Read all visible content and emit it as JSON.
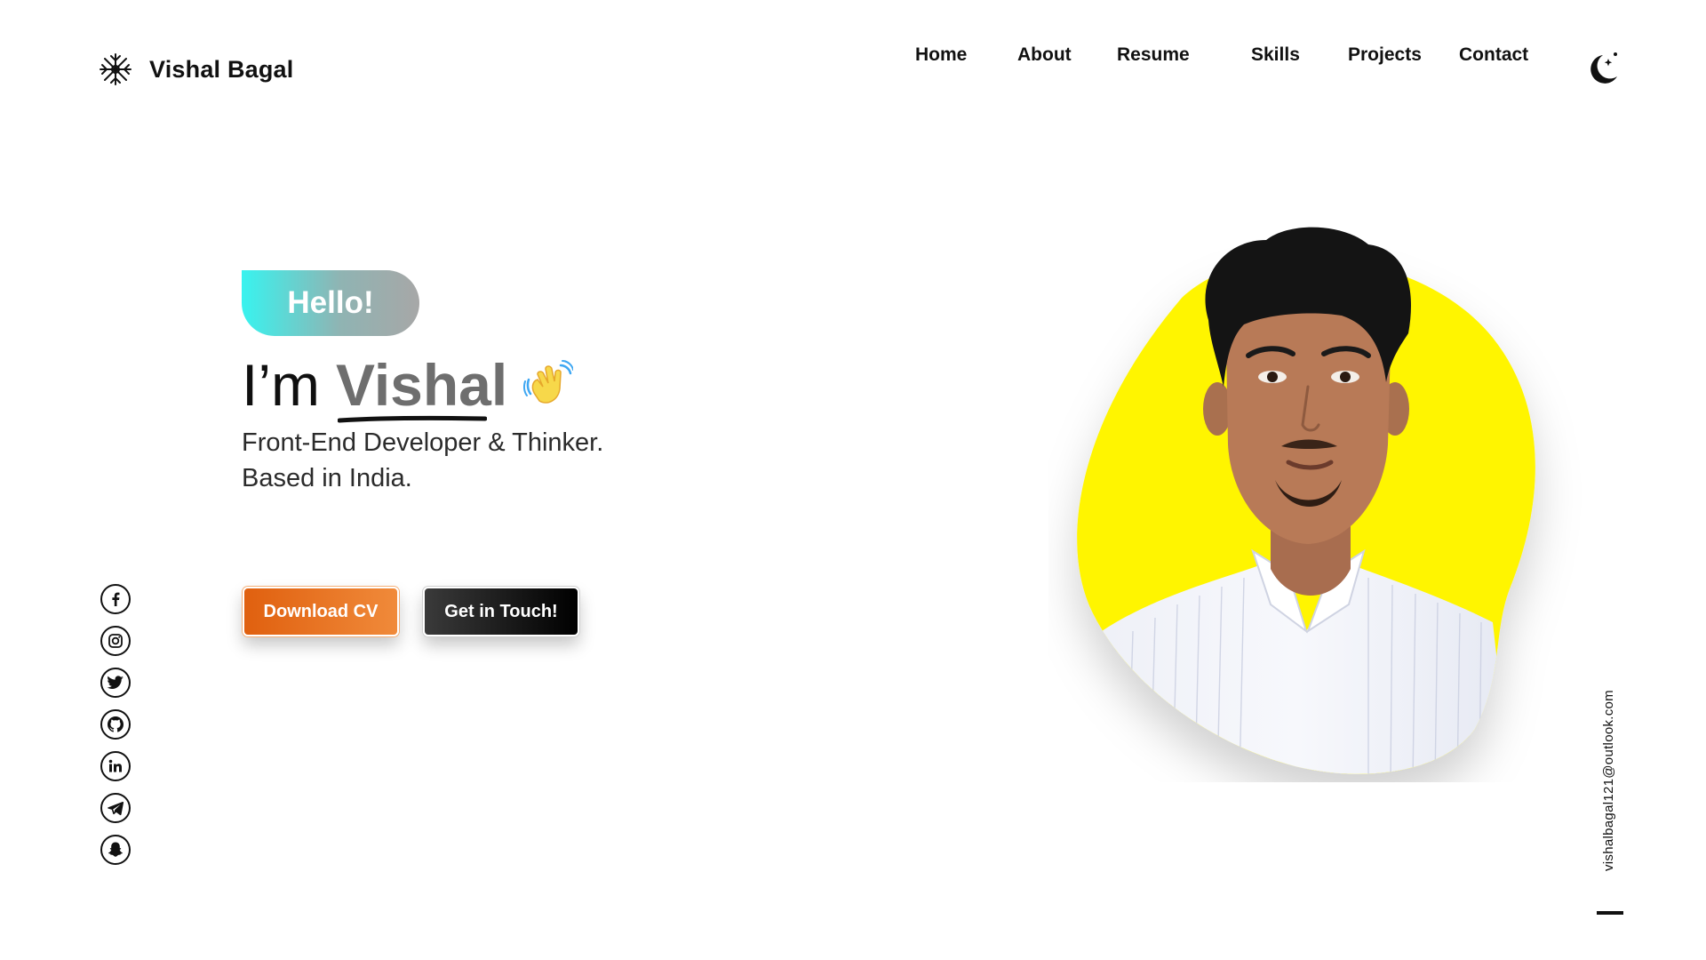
{
  "header": {
    "brand_name": "Vishal Bagal",
    "logo_icon": "snowflake-icon",
    "nav": [
      {
        "label": "Home"
      },
      {
        "label": "About"
      },
      {
        "label": "Resume"
      },
      {
        "label": "Skills"
      },
      {
        "label": "Projects"
      },
      {
        "label": "Contact"
      }
    ],
    "theme_toggle_icon": "moon-icon"
  },
  "hero": {
    "hello": "Hello!",
    "im": "I’m",
    "name": "Vishal",
    "wave_icon": "waving-hand-icon",
    "tagline_line1": "Front-End Developer & Thinker.",
    "tagline_line2": "Based in India.",
    "download_cv": "Download CV",
    "get_in_touch": "Get in Touch!"
  },
  "social": [
    {
      "name": "facebook-icon"
    },
    {
      "name": "instagram-icon"
    },
    {
      "name": "twitter-icon"
    },
    {
      "name": "github-icon"
    },
    {
      "name": "linkedin-icon"
    },
    {
      "name": "telegram-icon"
    },
    {
      "name": "snapchat-icon"
    }
  ],
  "contact": {
    "email": "vishalbagal121@outlook.com"
  },
  "colors": {
    "accent_yellow": "#fff500",
    "hello_gradient_start": "#38f3ef",
    "hello_gradient_end": "#a7a7a7",
    "download_orange": "#e0600f",
    "touch_black": "#000000",
    "name_gray": "#6e6e6e"
  }
}
